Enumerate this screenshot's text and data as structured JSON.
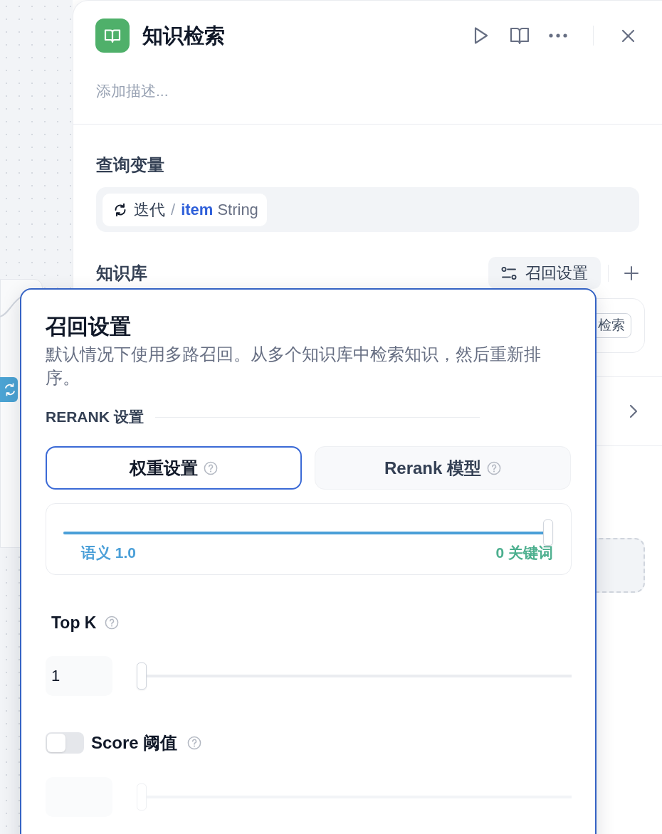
{
  "panel": {
    "title": "知识检索",
    "description": {
      "placeholder": "添加描述..."
    },
    "query_variable": {
      "label": "查询变量",
      "variable": {
        "source": "迭代",
        "separator": "/",
        "name": "item",
        "type": "String"
      }
    },
    "knowledge_base": {
      "label": "知识库",
      "settings_button": "召回设置",
      "items": [
        {
          "badge": "检索"
        }
      ]
    }
  },
  "recall_settings": {
    "title": "召回设置",
    "description": "默认情况下使用多路召回。从多个知识库中检索知识，然后重新排序。",
    "section_title": "RERANK 设置",
    "tabs": [
      {
        "label": "权重设置",
        "selected": true
      },
      {
        "label": "Rerank 模型",
        "selected": false
      }
    ],
    "weights": {
      "level": 1,
      "semantic_label": "语义 1.0",
      "keyword_label": "0 关键词"
    },
    "top_k": {
      "label": "Top K",
      "value": "1",
      "level": 0
    },
    "score_threshold": {
      "label": "Score 阈值",
      "on": false,
      "level": 0
    }
  }
}
